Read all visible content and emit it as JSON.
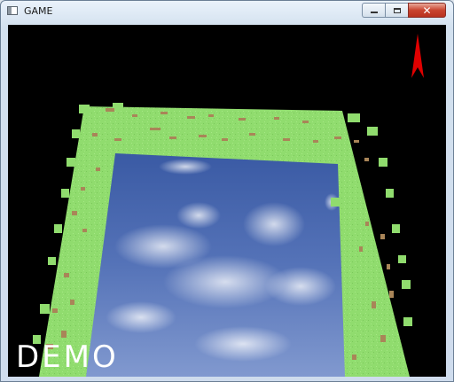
{
  "window": {
    "title": "GAME",
    "icon": "app-window-icon",
    "controls": {
      "minimize_icon": "minimize-icon",
      "maximize_icon": "maximize-icon",
      "close_glyph": "✕"
    }
  },
  "game": {
    "overlay_text": "DEMO",
    "compass_icon": "red-arrow-compass-icon",
    "colors": {
      "background": "#000000",
      "grass": "#8ed86c",
      "dirt": "#b08a5a",
      "sky_top": "#3d5fa8",
      "sky_bottom": "#7a95cf",
      "compass": "#e00000"
    }
  }
}
